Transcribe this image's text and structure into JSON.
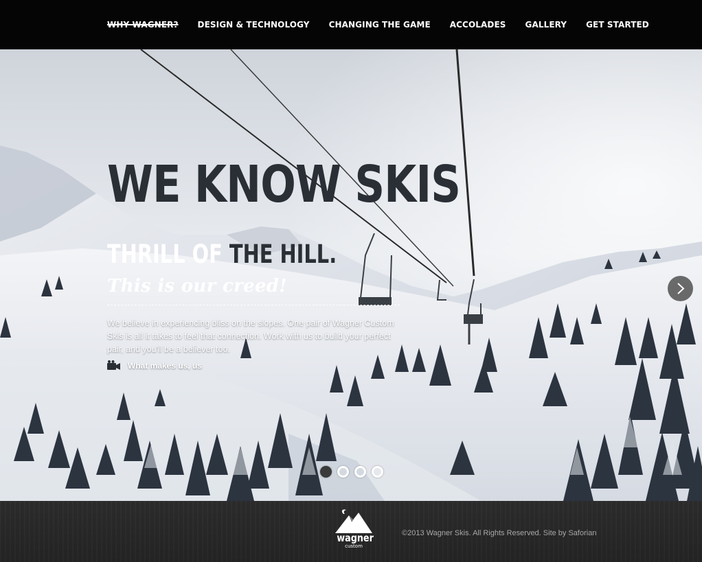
{
  "nav": {
    "items": [
      {
        "label": "WHY WAGNER?",
        "active": true
      },
      {
        "label": "DESIGN & TECHNOLOGY",
        "active": false
      },
      {
        "label": "CHANGING THE GAME",
        "active": false
      },
      {
        "label": "ACCOLADES",
        "active": false
      },
      {
        "label": "GALLERY",
        "active": false
      },
      {
        "label": "GET STARTED",
        "active": false
      }
    ]
  },
  "hero": {
    "headline": "WE KNOW SKIS",
    "subhead_part1": "THRILL OF ",
    "subhead_part2": "THE HILL.",
    "creed": "This is our creed!",
    "body": "We believe in experiencing bliss on the slopes. One pair of Wagner Custom Skis is all it takes to feel that connection. Work with us to build your perfect pair, and you'll be a believer too.",
    "video_link_label": "What makes us, us",
    "video_icon": "video-camera-icon",
    "next_icon": "chevron-right-icon",
    "slides_total": 4,
    "slide_active": 1
  },
  "footer": {
    "logo_word": "wagner",
    "logo_sub": "custom",
    "copyright": "©2013 Wagner Skis. All Rights Reserved. Site by Saforian"
  },
  "colors": {
    "nav_bg": "#050505",
    "headline": "#2a2f36",
    "footer_bg": "#262626",
    "footer_text": "#a8a8a8"
  }
}
